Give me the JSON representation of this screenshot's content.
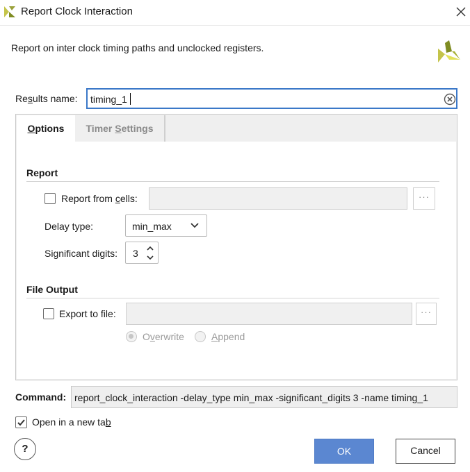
{
  "window": {
    "title": "Report Clock Interaction"
  },
  "header": {
    "description": "Report on inter clock timing paths and unclocked registers."
  },
  "results": {
    "label_pre": "Re",
    "label_u": "s",
    "label_post": "ults name:",
    "value": "timing_1"
  },
  "tabs": [
    {
      "label_pre": "",
      "label_u": "O",
      "label_post": "ptions"
    },
    {
      "label_pre": "Timer ",
      "label_u": "S",
      "label_post": "ettings"
    }
  ],
  "report": {
    "title": "Report",
    "from_cells_pre": "Report from ",
    "from_cells_u": "c",
    "from_cells_post": "ells:",
    "from_cells_browse": "···",
    "delay_type_label": "Delay type:",
    "delay_type_value": "min_max",
    "sig_digits_label": "Significant digits:",
    "sig_digits_value": "3"
  },
  "file_output": {
    "title": "File Output",
    "export_label": "Export to file:",
    "export_browse": "···",
    "overwrite_pre": "O",
    "overwrite_u": "v",
    "overwrite_post": "erwrite",
    "append_u": "A",
    "append_post": "ppend"
  },
  "command": {
    "label": "Command:",
    "value": "report_clock_interaction -delay_type min_max -significant_digits 3 -name timing_1"
  },
  "open_new_tab": {
    "label_pre": "Open in a new ta",
    "label_u": "b",
    "checked": true
  },
  "buttons": {
    "help": "?",
    "ok": "OK",
    "cancel": "Cancel"
  },
  "colors": {
    "accent": "#3b78c8",
    "ok_button": "#5b87d1",
    "logo_yellow": "#c4c44a",
    "logo_green": "#7f8c22"
  }
}
